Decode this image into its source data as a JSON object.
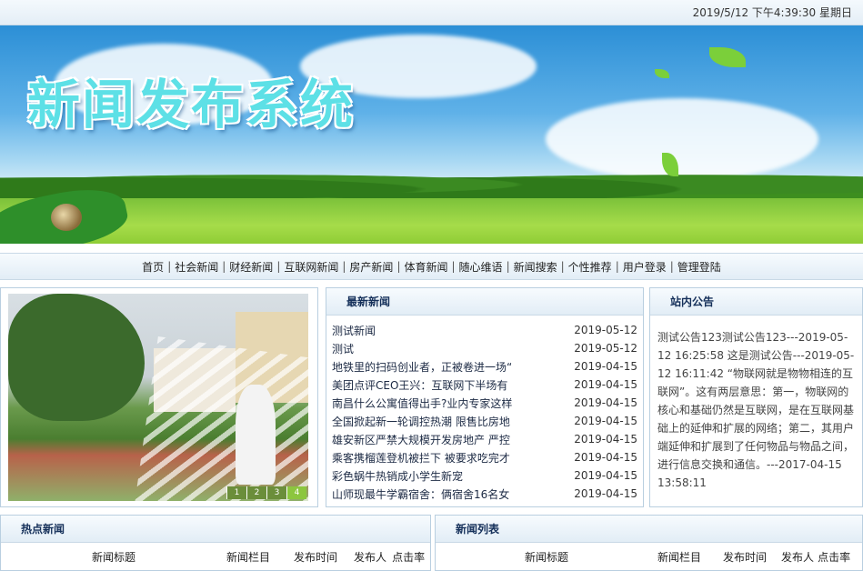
{
  "datetime": "2019/5/12 下午4:39:30  星期日",
  "banner": {
    "title": "新闻发布系统"
  },
  "nav": {
    "items": [
      "首页",
      "社会新闻",
      "财经新闻",
      "互联网新闻",
      "房产新闻",
      "体育新闻",
      "随心维语",
      "新闻搜索",
      "个性推荐",
      "用户登录",
      "管理登陆"
    ]
  },
  "slideshow": {
    "pages": [
      "1",
      "2",
      "3",
      "4"
    ],
    "active_page": 4
  },
  "latest": {
    "title": "最新新闻",
    "items": [
      {
        "title": "测试新闻",
        "date": "2019-05-12"
      },
      {
        "title": "测试",
        "date": "2019-05-12"
      },
      {
        "title": "地铁里的扫码创业者，正被卷进一场“",
        "date": "2019-04-15"
      },
      {
        "title": "美团点评CEO王兴：互联网下半场有",
        "date": "2019-04-15"
      },
      {
        "title": "南昌什么公寓值得出手?业内专家这样",
        "date": "2019-04-15"
      },
      {
        "title": "全国掀起新一轮调控热潮 限售比房地",
        "date": "2019-04-15"
      },
      {
        "title": "雄安新区严禁大规模开发房地产 严控",
        "date": "2019-04-15"
      },
      {
        "title": "乘客携榴莲登机被拦下 被要求吃完才",
        "date": "2019-04-15"
      },
      {
        "title": "彩色蜗牛热销成小学生新宠",
        "date": "2019-04-15"
      },
      {
        "title": "山师现最牛学霸宿舍：俩宿舍16名女",
        "date": "2019-04-15"
      }
    ]
  },
  "notice": {
    "title": "站内公告",
    "text": "测试公告123测试公告123---2019-05-12 16:25:58 这是测试公告---2019-05-12 16:11:42 “物联网就是物物相连的互联网”。这有两层意思：第一，物联网的核心和基础仍然是互联网，是在互联网基础上的延伸和扩展的网络；第二，其用户端延伸和扩展到了任何物品与物品之间，进行信息交换和通信。---2017-04-15 13:58:11"
  },
  "hot": {
    "title": "热点新闻",
    "columns": [
      "新闻标题",
      "新闻栏目",
      "发布时间",
      "发布人",
      "点击率"
    ]
  },
  "newslist": {
    "title": "新闻列表",
    "columns": [
      "新闻标题",
      "新闻栏目",
      "发布时间",
      "发布人",
      "点击率"
    ]
  }
}
